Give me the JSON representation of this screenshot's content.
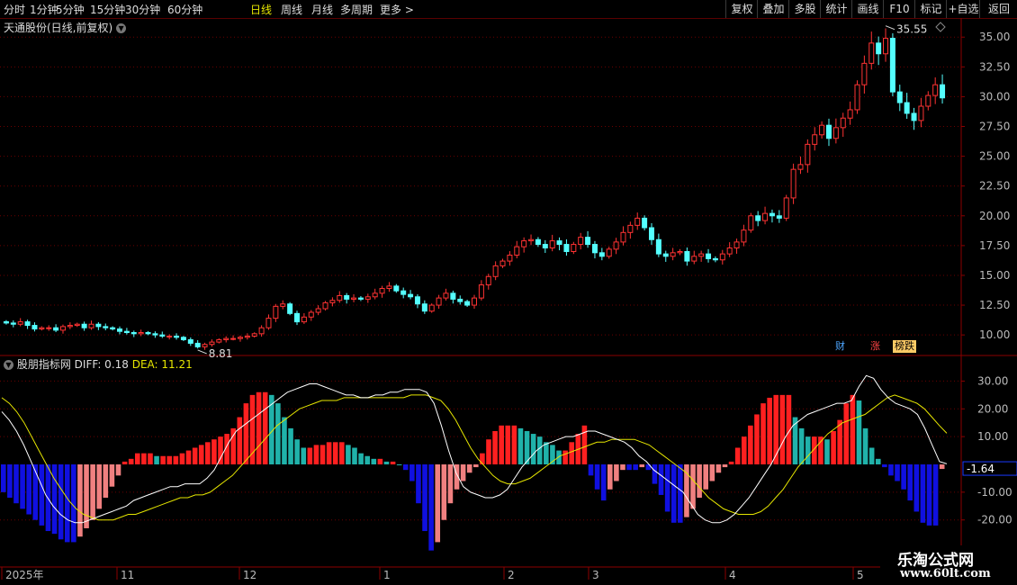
{
  "toolbar": {
    "left_items": [
      "分时",
      "1分钟",
      "5分钟",
      "15分钟",
      "30分钟",
      "60分钟",
      "日线",
      "周线",
      "月线",
      "多周期",
      "更多 >"
    ],
    "active": "日线",
    "right_items": [
      "复权",
      "叠加",
      "多股",
      "统计",
      "画线",
      "F10",
      "标记",
      "+自选",
      "返回"
    ]
  },
  "symbol_title": "天通股份(日线,前复权)",
  "badges": [
    {
      "text": "财",
      "color": "#4da6ff",
      "bg": "#000"
    },
    {
      "text": "涨",
      "color": "#ff4444",
      "bg": "#000"
    },
    {
      "text": "榜跌",
      "color": "#000",
      "bg": "#ffcc66"
    }
  ],
  "indicator": {
    "name": "股朋指标网",
    "diff_label": "DIFF: 0.18",
    "dea_label": "DEA: 11.21",
    "current_tag": "-1.64"
  },
  "x_axis_labels": [
    "2025年",
    "11",
    "12",
    "1",
    "2",
    "3",
    "4",
    "5"
  ],
  "watermark": {
    "line1": "乐淘公式网",
    "line2": "www.60lt.com"
  },
  "colors": {
    "up": "#ff3333",
    "down": "#54ffff",
    "grid": "#6a0000",
    "diff": "#ffffff",
    "dea": "#e6e600",
    "hist_pos_red": "#ff2020",
    "hist_pos_cyan": "#20b2aa",
    "hist_neg_blue": "#1010e0",
    "hist_neg_pink": "#f08080"
  },
  "chart_data": [
    {
      "type": "candlestick",
      "title": "天通股份(日线,前复权)",
      "y_ticks": [
        "35.00",
        "32.50",
        "30.00",
        "27.50",
        "25.00",
        "22.50",
        "20.00",
        "17.50",
        "15.00",
        "12.50",
        "10.00"
      ],
      "ylim": [
        8.5,
        36
      ],
      "annotations": [
        {
          "text": "35.55",
          "type": "high"
        },
        {
          "text": "8.81",
          "type": "low"
        }
      ],
      "x_labels": [
        "2025年",
        "11",
        "12",
        "1",
        "2",
        "3",
        "4",
        "5"
      ],
      "close": [
        11.0,
        10.9,
        11.1,
        10.8,
        10.5,
        10.6,
        10.6,
        10.4,
        10.7,
        10.8,
        10.9,
        10.6,
        10.9,
        10.7,
        10.6,
        10.5,
        10.3,
        10.2,
        10.1,
        10.2,
        10.1,
        10.0,
        9.9,
        9.9,
        9.8,
        9.6,
        9.3,
        9.0,
        9.2,
        9.4,
        9.6,
        9.7,
        9.7,
        9.8,
        9.9,
        10.1,
        10.6,
        11.4,
        12.4,
        12.6,
        11.8,
        11.1,
        11.5,
        11.9,
        12.2,
        12.7,
        12.9,
        13.3,
        13.0,
        13.1,
        13.0,
        13.2,
        13.5,
        13.9,
        14.1,
        13.7,
        13.4,
        13.2,
        12.6,
        12.0,
        12.5,
        13.1,
        13.5,
        13.0,
        12.8,
        12.5,
        13.1,
        14.2,
        14.9,
        15.8,
        16.2,
        16.7,
        17.4,
        17.9,
        18.0,
        17.6,
        17.3,
        17.9,
        17.6,
        17.0,
        17.6,
        18.2,
        17.6,
        16.9,
        16.6,
        17.2,
        17.8,
        18.6,
        19.2,
        19.8,
        19.0,
        18.0,
        16.8,
        16.6,
        16.9,
        17.0,
        16.2,
        16.6,
        16.8,
        16.4,
        16.3,
        16.8,
        17.3,
        17.8,
        18.8,
        20.0,
        19.6,
        20.2,
        20.0,
        19.8,
        21.5,
        23.9,
        24.3,
        26.0,
        26.8,
        27.6,
        26.5,
        27.4,
        28.2,
        28.9,
        31.0,
        32.8,
        34.5,
        33.6,
        34.9,
        30.4,
        29.5,
        28.6,
        28.0,
        29.2,
        30.1,
        31.0,
        29.9
      ]
    },
    {
      "type": "macd",
      "title": "股朋指标网",
      "y_ticks": [
        "30.00",
        "20.00",
        "10.00",
        "-10.00",
        "-20.00"
      ],
      "ylim": [
        -35,
        35
      ],
      "series": [
        {
          "name": "DIFF",
          "values": [
            19,
            16,
            12,
            7,
            1,
            -5,
            -11,
            -15,
            -18,
            -20,
            -21,
            -21,
            -20,
            -19,
            -18,
            -17,
            -16,
            -15,
            -13,
            -12,
            -11,
            -10,
            -9,
            -8,
            -8,
            -7,
            -7,
            -7,
            -5,
            -2,
            3,
            8,
            12,
            14,
            16,
            18,
            20,
            22,
            24,
            26,
            27,
            28,
            29,
            29,
            28,
            27,
            26,
            25,
            25,
            24,
            24,
            25,
            25,
            26,
            26,
            27,
            27,
            27,
            26,
            22,
            14,
            5,
            -3,
            -8,
            -10,
            -11,
            -12,
            -12,
            -11,
            -9,
            -5,
            -1,
            2,
            5,
            7,
            8,
            9,
            10,
            10,
            11,
            12,
            12,
            11,
            10,
            9,
            8,
            6,
            3,
            1,
            -2,
            -4,
            -6,
            -8,
            -10,
            -14,
            -18,
            -20,
            -21,
            -21,
            -20,
            -18,
            -15,
            -12,
            -8,
            -4,
            0,
            5,
            10,
            14,
            16,
            18,
            19,
            20,
            21,
            22,
            22,
            23,
            28,
            32,
            31,
            27,
            24,
            22,
            21,
            20,
            18,
            13,
            7,
            1,
            0.18
          ]
        },
        {
          "name": "DEA",
          "values": [
            24,
            22,
            19,
            15,
            10,
            5,
            0,
            -5,
            -9,
            -13,
            -16,
            -18,
            -19,
            -20,
            -20,
            -20,
            -19,
            -18,
            -18,
            -17,
            -16,
            -15,
            -14,
            -13,
            -12,
            -12,
            -11,
            -11,
            -10,
            -8,
            -6,
            -4,
            -1,
            2,
            5,
            8,
            11,
            14,
            16,
            18,
            20,
            21,
            22,
            23,
            23,
            23,
            24,
            24,
            24,
            24,
            24,
            24,
            24,
            24,
            24,
            25,
            25,
            25,
            24,
            23,
            20,
            16,
            11,
            6,
            2,
            -1,
            -4,
            -6,
            -7,
            -7,
            -6,
            -5,
            -3,
            -1,
            1,
            3,
            4,
            5,
            6,
            7,
            8,
            8,
            9,
            9,
            9,
            9,
            8,
            7,
            5,
            3,
            1,
            -1,
            -3,
            -6,
            -9,
            -12,
            -14,
            -16,
            -17,
            -18,
            -18,
            -18,
            -17,
            -15,
            -12,
            -9,
            -5,
            -1,
            2,
            5,
            8,
            11,
            13,
            15,
            16,
            17,
            18,
            20,
            22,
            24,
            25,
            24,
            23,
            22,
            20,
            17,
            14,
            11.21
          ]
        },
        {
          "name": "MACD",
          "values": [
            -10,
            -12,
            -14,
            -16,
            -18,
            -20,
            -22,
            -24,
            -25,
            -27,
            -28,
            -28,
            -26,
            -23,
            -20,
            -16,
            -12,
            -8,
            -4,
            1,
            2,
            4,
            4,
            4,
            3,
            3,
            3,
            3,
            4,
            5,
            6,
            7,
            8,
            9,
            10,
            11,
            13,
            17,
            22,
            25,
            26,
            26,
            25,
            22,
            17,
            13,
            9,
            6,
            6,
            7,
            7,
            8,
            8,
            8,
            7,
            6,
            4,
            3,
            2,
            2,
            1,
            1,
            0,
            -2,
            -6,
            -14,
            -24,
            -31,
            -28,
            -20,
            -14,
            -9,
            -6,
            -3,
            -1,
            4,
            9,
            12,
            14,
            14,
            14,
            13,
            12,
            11,
            10,
            8,
            7,
            5,
            5,
            8,
            11,
            14,
            -4,
            -9,
            -13,
            -9,
            -6,
            -2,
            -2,
            -2,
            -1,
            -2,
            -7,
            -11,
            -17,
            -21,
            -21,
            -19,
            -16,
            -12,
            -9,
            -6,
            -3,
            -1,
            1,
            6,
            10,
            14,
            18,
            22,
            24,
            25,
            25,
            25,
            17,
            13,
            10,
            10,
            10,
            9,
            12,
            16,
            22,
            25,
            23,
            13,
            6,
            2,
            -1,
            -4,
            -6,
            -9,
            -13,
            -17,
            -21,
            -22,
            -22,
            -1.64
          ]
        }
      ]
    }
  ]
}
